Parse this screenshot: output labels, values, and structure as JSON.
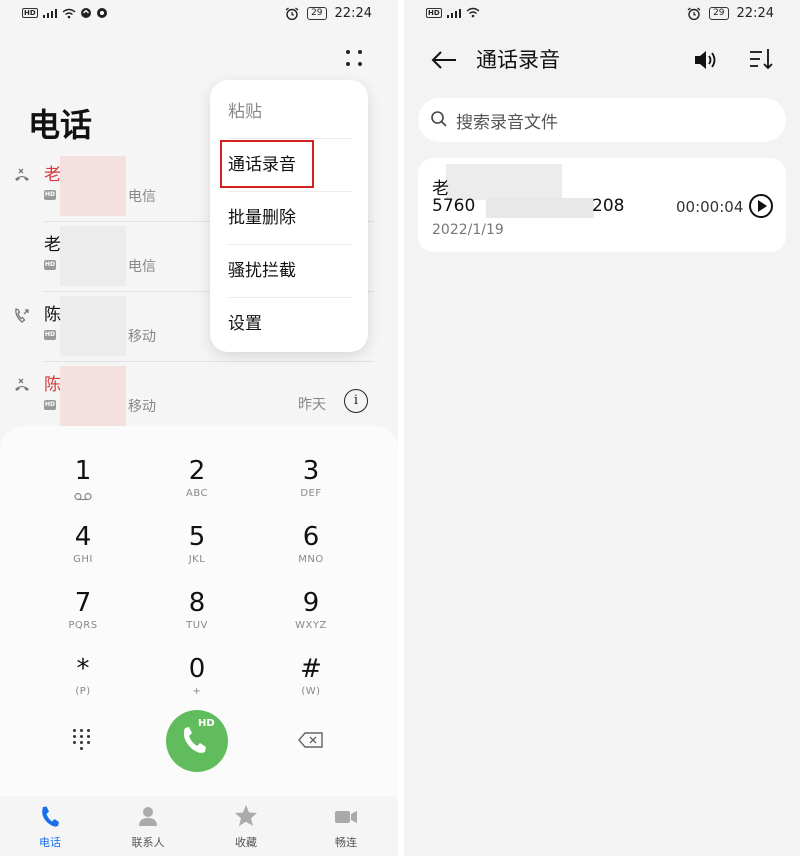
{
  "status_bar": {
    "time": "22:24",
    "battery": "29",
    "hd": "HD"
  },
  "left": {
    "title": "电话",
    "calls": [
      {
        "name": "老",
        "carrier": "电信",
        "missed": true,
        "icon": "missed-call-icon",
        "hd": "HD"
      },
      {
        "name": "老",
        "carrier": "电信",
        "missed": false,
        "icon": "none",
        "hd": "HD"
      },
      {
        "name": "陈",
        "carrier": "移动",
        "missed": false,
        "icon": "outgoing-call-icon",
        "hd": "HD"
      },
      {
        "name": "陈",
        "carrier": "移动",
        "missed": true,
        "icon": "missed-call-icon",
        "hd": "HD",
        "when": "昨天",
        "info": "i"
      }
    ],
    "menu": {
      "paste": "粘贴",
      "call_recording": "通话录音",
      "batch_delete": "批量删除",
      "harass_block": "骚扰拦截",
      "settings": "设置"
    },
    "highlight_color": "#d32020",
    "dialpad": {
      "keys": [
        {
          "digit": "1",
          "sub": "voicemail-icon"
        },
        {
          "digit": "2",
          "sub": "ABC"
        },
        {
          "digit": "3",
          "sub": "DEF"
        },
        {
          "digit": "4",
          "sub": "GHI"
        },
        {
          "digit": "5",
          "sub": "JKL"
        },
        {
          "digit": "6",
          "sub": "MNO"
        },
        {
          "digit": "7",
          "sub": "PQRS"
        },
        {
          "digit": "8",
          "sub": "TUV"
        },
        {
          "digit": "9",
          "sub": "WXYZ"
        },
        {
          "digit": "*",
          "sub": "(P)"
        },
        {
          "digit": "0",
          "sub": "+"
        },
        {
          "digit": "#",
          "sub": "(W)"
        }
      ],
      "call_hd": "HD",
      "call_color": "#60bc5d"
    },
    "tabs": [
      {
        "label": "电话",
        "icon": "phone-icon",
        "active": true
      },
      {
        "label": "联系人",
        "icon": "contacts-icon",
        "active": false
      },
      {
        "label": "收藏",
        "icon": "star-icon",
        "active": false
      },
      {
        "label": "畅连",
        "icon": "video-call-icon",
        "active": false
      }
    ],
    "accent": "#1a6fe8"
  },
  "right": {
    "title": "通话录音",
    "search_placeholder": "搜索录音文件",
    "record": {
      "name": "老",
      "number_start": "5760",
      "number_end": "208",
      "date": "2022/1/19",
      "duration": "00:00:04"
    }
  }
}
